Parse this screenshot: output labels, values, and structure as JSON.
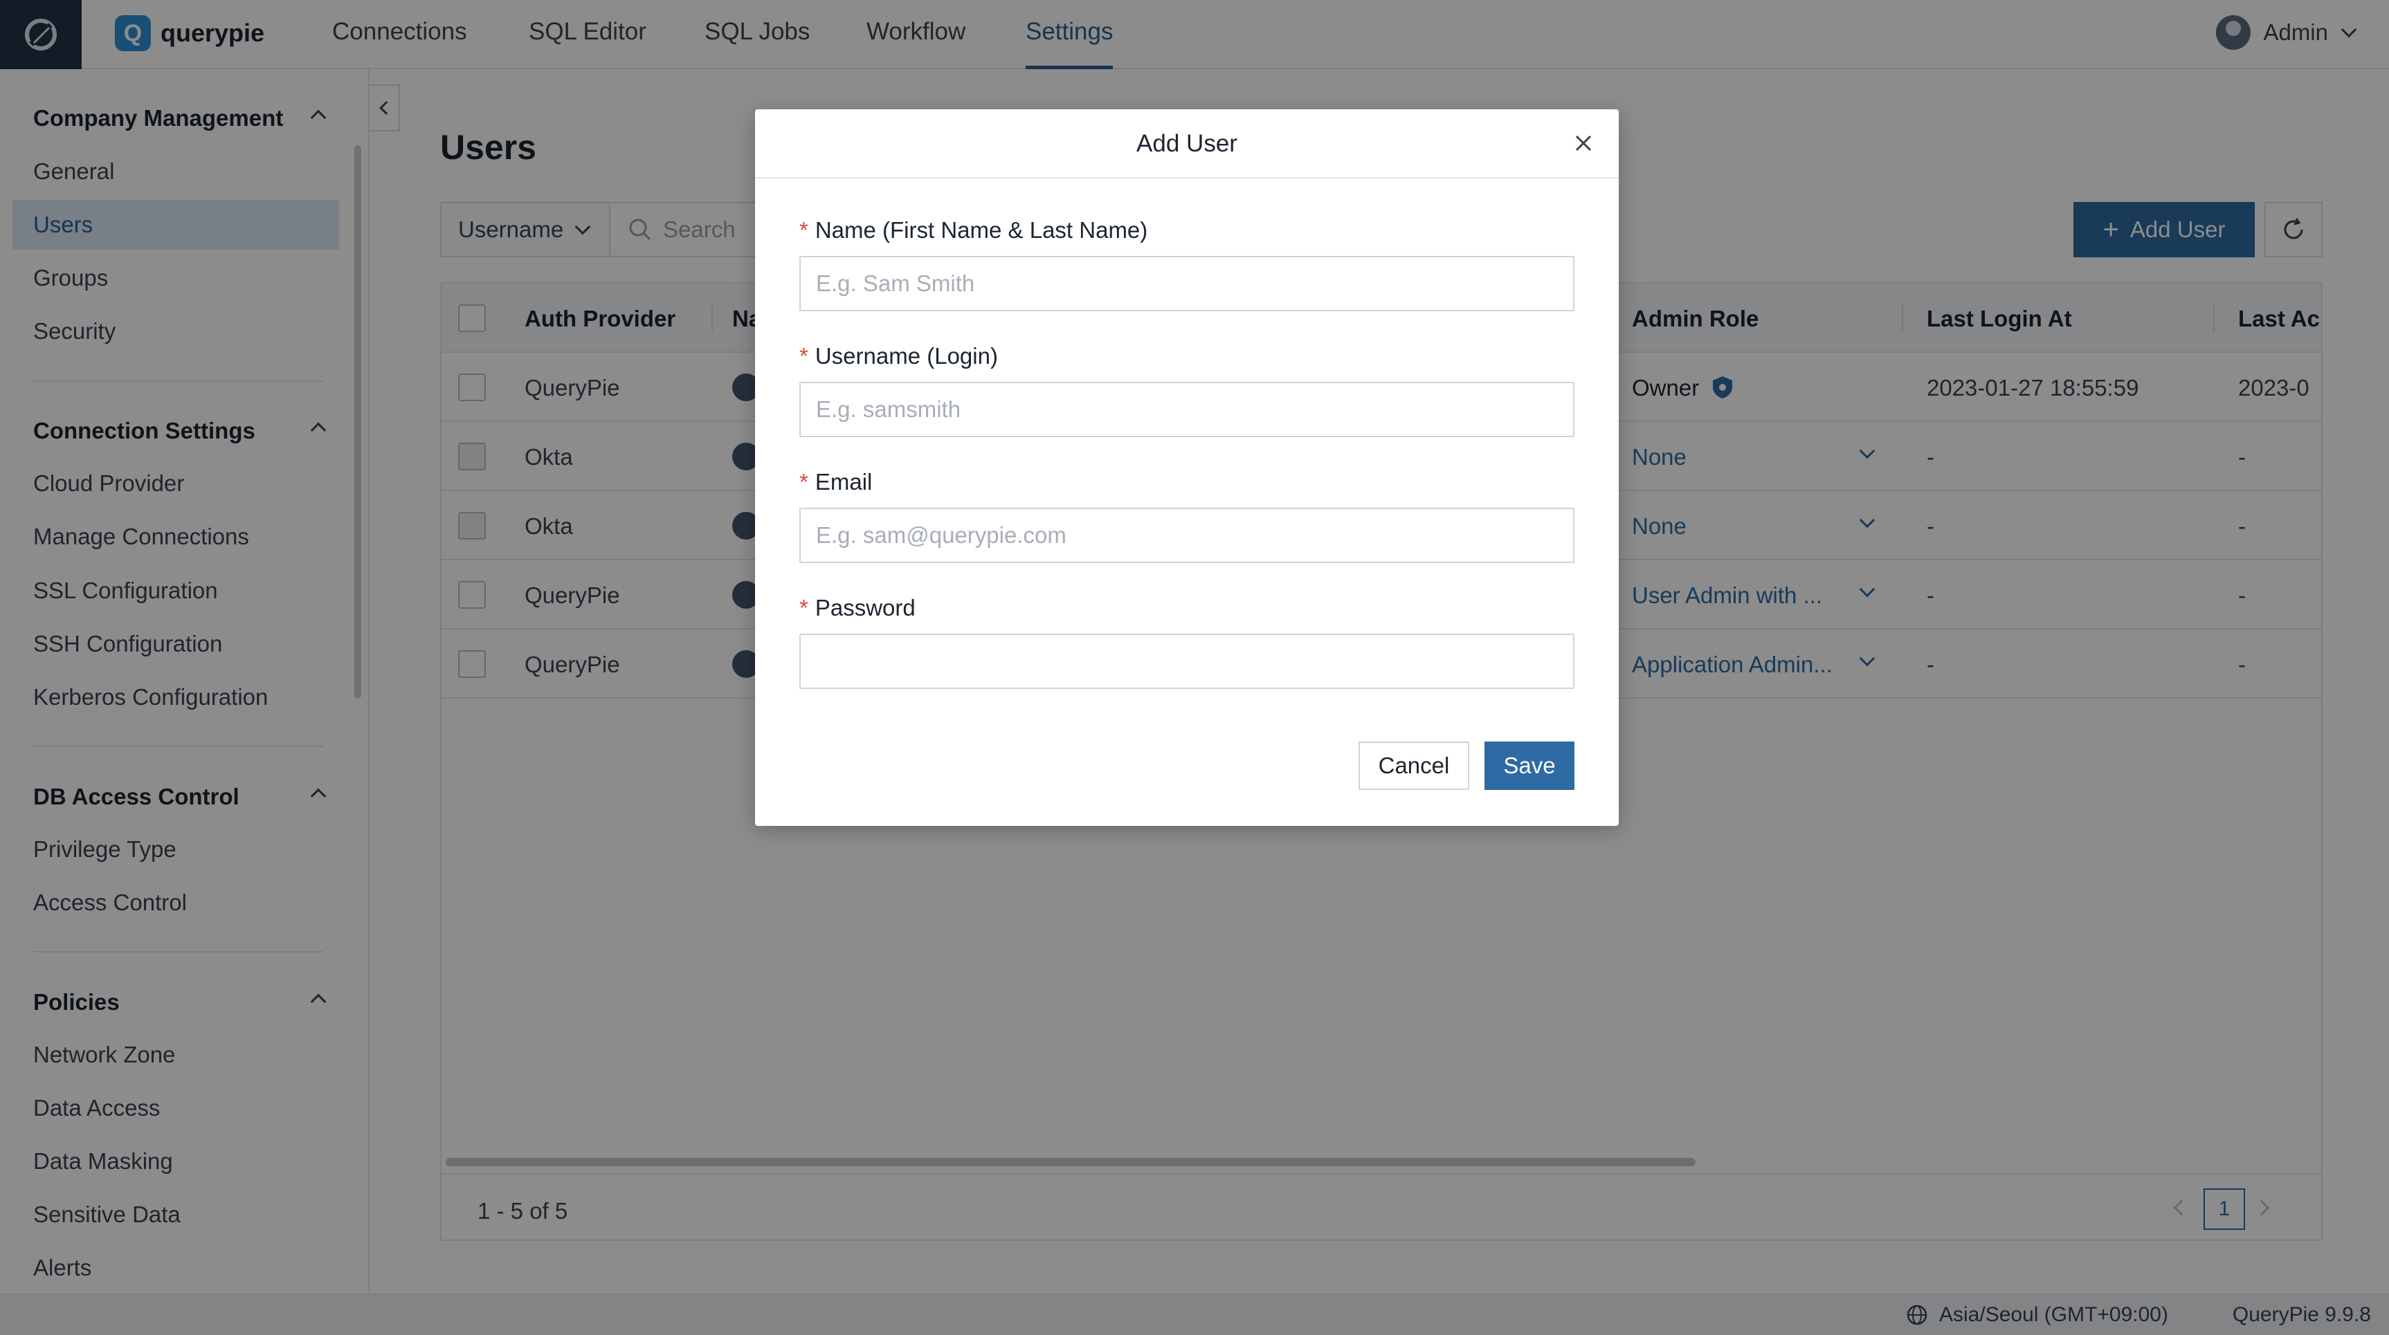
{
  "nav": {
    "brand": "querypie",
    "items": [
      "Connections",
      "SQL Editor",
      "SQL Jobs",
      "Workflow",
      "Settings"
    ],
    "active": "Settings",
    "account": "Admin"
  },
  "sidebar": {
    "sections": [
      {
        "title": "Company Management",
        "items": [
          "General",
          "Users",
          "Groups",
          "Security"
        ]
      },
      {
        "title": "Connection Settings",
        "items": [
          "Cloud Provider",
          "Manage Connections",
          "SSL Configuration",
          "SSH Configuration",
          "Kerberos Configuration"
        ]
      },
      {
        "title": "DB Access Control",
        "items": [
          "Privilege Type",
          "Access Control"
        ]
      },
      {
        "title": "Policies",
        "items": [
          "Network Zone",
          "Data Access",
          "Data Masking",
          "Sensitive Data",
          "Alerts"
        ]
      }
    ],
    "active": "Users"
  },
  "main": {
    "title": "Users",
    "filter": "Username",
    "search_placeholder": "Search",
    "add_button": "Add User",
    "columns": [
      "Auth Provider",
      "Na",
      "Admin Role",
      "Last Login At",
      "Last Ac"
    ],
    "rows": [
      {
        "provider": "QueryPie",
        "role": "Owner",
        "last_login": "2023-01-27 18:55:59",
        "last_access": "2023-0"
      },
      {
        "provider": "Okta",
        "role": "None",
        "last_login": "-",
        "last_access": "-"
      },
      {
        "provider": "Okta",
        "role": "None",
        "last_login": "-",
        "last_access": "-"
      },
      {
        "provider": "QueryPie",
        "role": "User Admin  with ...",
        "last_login": "-",
        "last_access": "-"
      },
      {
        "provider": "QueryPie",
        "role": "Application Admin...",
        "last_login": "-",
        "last_access": "-"
      }
    ],
    "pagination": {
      "summary": "1 - 5 of 5",
      "page": "1"
    }
  },
  "modal": {
    "title": "Add User",
    "fields": [
      {
        "label": "Name (First Name & Last Name)",
        "placeholder": "E.g. Sam Smith",
        "value": ""
      },
      {
        "label": "Username (Login)",
        "placeholder": "E.g. samsmith",
        "value": ""
      },
      {
        "label": "Email",
        "placeholder": "E.g. sam@querypie.com",
        "value": ""
      },
      {
        "label": "Password",
        "placeholder": "",
        "value": ""
      }
    ],
    "required_mark": "*",
    "cancel": "Cancel",
    "save": "Save"
  },
  "status": {
    "timezone": "Asia/Seoul (GMT+09:00)",
    "version": "QueryPie 9.9.8"
  },
  "colors": {
    "accent": "#2e6aa3",
    "sidebar_active_bg": "#dbe8f5",
    "brand_tile": "#1f3446",
    "required": "#e0483e"
  }
}
